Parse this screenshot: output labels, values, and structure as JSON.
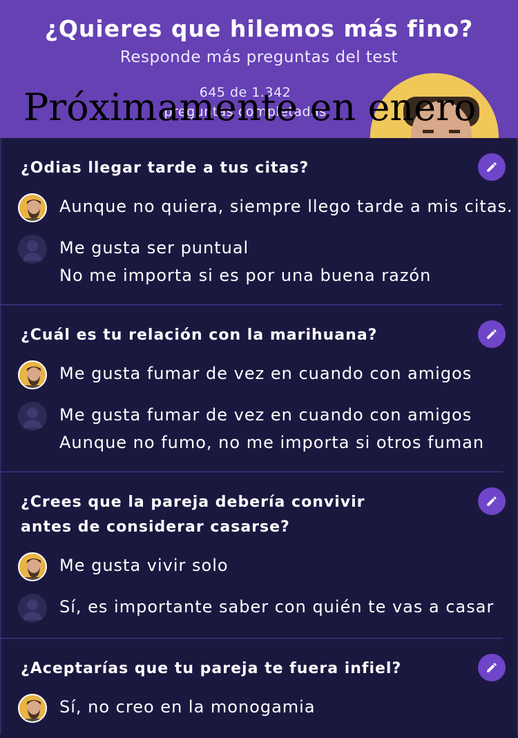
{
  "header": {
    "title": "¿Quieres que hilemos más fino?",
    "subtitle": "Responde más preguntas del test",
    "count": "645 de 1.342",
    "count_label": "preguntas completadas",
    "overlay": "Próximamente en enero"
  },
  "questions": [
    {
      "text": "¿Odias llegar tarde a tus citas?",
      "my_answer": "Aunque no quiera, siempre llego tarde a mis citas.",
      "their_answers": [
        "Me gusta ser puntual",
        "No me importa si es por una buena razón"
      ]
    },
    {
      "text": "¿Cuál es tu relación con la marihuana?",
      "my_answer": "Me gusta fumar de vez en cuando con amigos",
      "their_answers": [
        "Me gusta fumar de vez en cuando con amigos",
        "Aunque no fumo, no me importa si otros fuman"
      ]
    },
    {
      "text": "¿Crees que la pareja debería convivir antes de considerar casarse?",
      "my_answer": "Me gusta vivir solo",
      "their_answers": [
        "Sí, es importante saber con quién te vas a casar"
      ]
    },
    {
      "text": "¿Aceptarías que tu pareja te fuera infiel?",
      "my_answer": "Sí, no creo en la monogamia",
      "their_answers": []
    }
  ],
  "colors": {
    "header_bg": "#6541b4",
    "page_bg": "#1b1840",
    "accent": "#6f45c9",
    "avatar_bg": "#e9b444"
  }
}
